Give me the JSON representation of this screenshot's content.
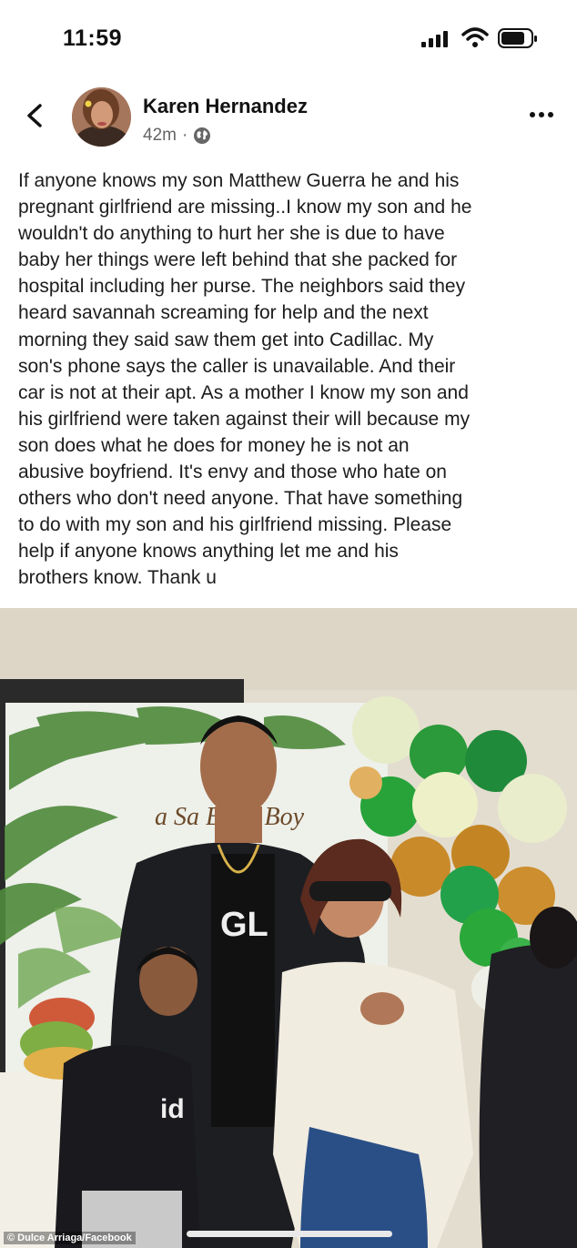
{
  "status_bar": {
    "time": "11:59"
  },
  "post": {
    "author_name": "Karen Hernandez",
    "time_ago": "42m",
    "separator": "·",
    "privacy_icon": "globe-icon",
    "text": "If anyone knows my son Matthew Guerra he and his pregnant girlfriend are missing..I know my son and he wouldn't do anything to hurt her she is due to have baby her things were left behind that she packed for hospital including her purse. The neighbors said they heard savannah screaming for help and the next morning they said saw them get into Cadillac. My son's phone says the caller is unavailable. And their car is not at their apt. As a mother I know my son and his girlfriend were taken against their will because my son does what he does for money he is not an abusive boyfriend. It's envy and those who hate on others who don't need anyone. That have something to do with my son and his girlfriend missing. Please help if anyone knows anything let me and his brothers know. Thank u",
    "text_lines": [
      "If anyone knows my son Matthew Guerra he and his",
      "pregnant girlfriend are missing..I know my son and he",
      "wouldn't do anything to hurt her she is due to have",
      "baby her things were left behind that she packed for",
      "hospital including her purse. The neighbors said they",
      "heard savannah screaming for help and the next",
      "morning they said saw them get into Cadillac. My",
      "son's phone says the caller is unavailable. And their",
      "car is not at their apt. As a mother I know my son and",
      "his girlfriend were taken against their will because my",
      "son does what he does for money he is not an",
      "abusive boyfriend. It's envy and those who hate on",
      "others who don't need anyone. That have something",
      "to do with my son and his girlfriend missing. Please",
      "help if anyone knows anything let me and his",
      "brothers know. Thank u"
    ],
    "photo": {
      "banner_text": "a Sa     Baby Boy",
      "shirt_text": "GL",
      "kid_shirt_text": "id",
      "credit": "© Dulce Arriaga/Facebook"
    }
  },
  "icons": {
    "back": "chevron-left-icon",
    "more": "more-horizontal-icon",
    "signal": "cellular-signal-icon",
    "wifi": "wifi-icon",
    "battery": "battery-icon"
  }
}
